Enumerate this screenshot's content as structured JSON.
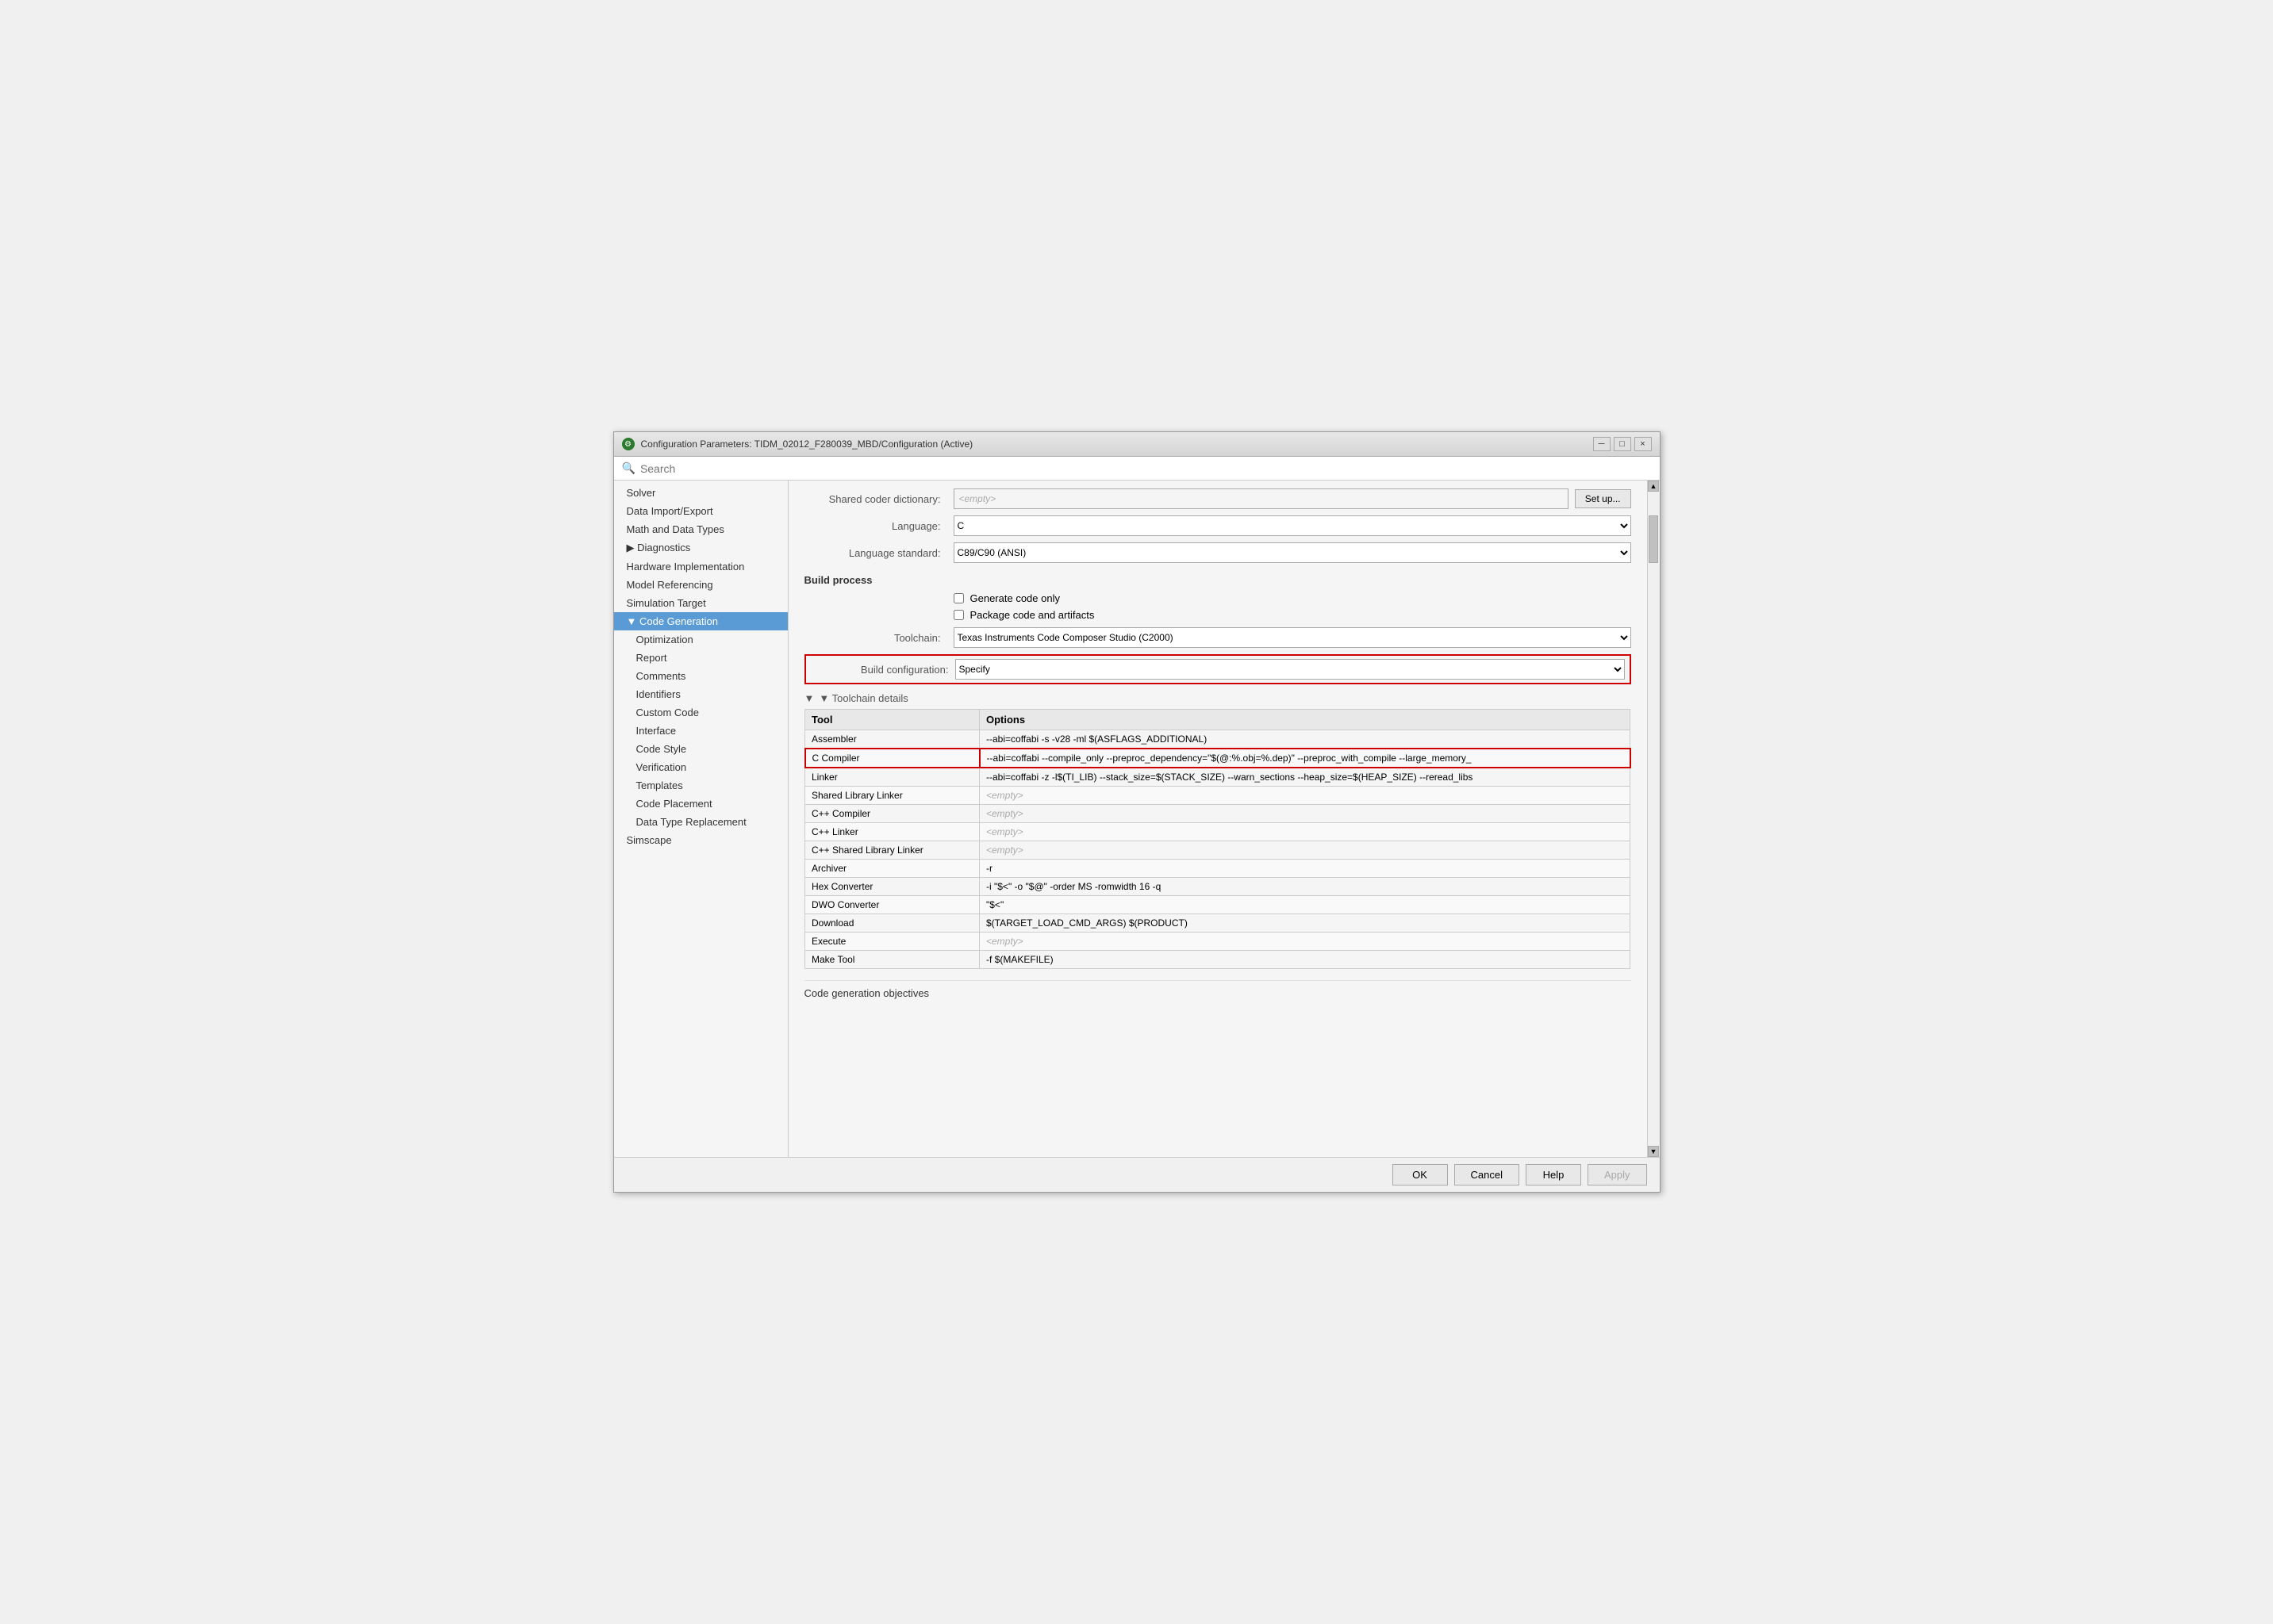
{
  "window": {
    "title": "Configuration Parameters: TIDM_02012_F280039_MBD/Configuration (Active)",
    "icon": "⚙"
  },
  "title_controls": {
    "minimize": "─",
    "maximize": "□",
    "close": "×"
  },
  "search": {
    "placeholder": "Search"
  },
  "sidebar": {
    "items": [
      {
        "id": "solver",
        "label": "Solver",
        "level": 0,
        "active": false
      },
      {
        "id": "data-import-export",
        "label": "Data Import/Export",
        "level": 0,
        "active": false
      },
      {
        "id": "math-data-types",
        "label": "Math and Data Types",
        "level": 0,
        "active": false
      },
      {
        "id": "diagnostics",
        "label": "▶ Diagnostics",
        "level": 0,
        "active": false
      },
      {
        "id": "hardware-impl",
        "label": "Hardware Implementation",
        "level": 0,
        "active": false
      },
      {
        "id": "model-referencing",
        "label": "Model Referencing",
        "level": 0,
        "active": false
      },
      {
        "id": "simulation-target",
        "label": "Simulation Target",
        "level": 0,
        "active": false
      },
      {
        "id": "code-generation",
        "label": "▼ Code Generation",
        "level": 0,
        "active": true
      },
      {
        "id": "optimization",
        "label": "Optimization",
        "level": 1,
        "active": false
      },
      {
        "id": "report",
        "label": "Report",
        "level": 1,
        "active": false
      },
      {
        "id": "comments",
        "label": "Comments",
        "level": 1,
        "active": false
      },
      {
        "id": "identifiers",
        "label": "Identifiers",
        "level": 1,
        "active": false
      },
      {
        "id": "custom-code",
        "label": "Custom Code",
        "level": 1,
        "active": false
      },
      {
        "id": "interface",
        "label": "Interface",
        "level": 1,
        "active": false
      },
      {
        "id": "code-style",
        "label": "Code Style",
        "level": 1,
        "active": false
      },
      {
        "id": "verification",
        "label": "Verification",
        "level": 1,
        "active": false
      },
      {
        "id": "templates",
        "label": "Templates",
        "level": 1,
        "active": false
      },
      {
        "id": "code-placement",
        "label": "Code Placement",
        "level": 1,
        "active": false
      },
      {
        "id": "data-type-replacement",
        "label": "Data Type Replacement",
        "level": 1,
        "active": false
      },
      {
        "id": "simscape",
        "label": "Simscape",
        "level": 0,
        "active": false
      }
    ]
  },
  "main": {
    "shared_coder_label": "Shared coder dictionary:",
    "shared_coder_value": "<empty>",
    "setup_btn": "Set up...",
    "language_label": "Language:",
    "language_value": "C",
    "language_standard_label": "Language standard:",
    "language_standard_value": "C89/C90 (ANSI)",
    "build_process_header": "Build process",
    "generate_code_only": "Generate code only",
    "package_code": "Package code and artifacts",
    "toolchain_label": "Toolchain:",
    "toolchain_value": "Texas Instruments Code Composer Studio (C2000)",
    "build_config_label": "Build configuration:",
    "build_config_value": "Specify",
    "toolchain_details_header": "▼ Toolchain details",
    "table": {
      "headers": [
        "Tool",
        "Options"
      ],
      "rows": [
        {
          "tool": "Assembler",
          "options": "--abi=coffabi -s -v28 -ml $(ASFLAGS_ADDITIONAL)",
          "highlighted": false,
          "empty": false
        },
        {
          "tool": "C Compiler",
          "options": "--abi=coffabi --compile_only --preproc_dependency=\"$(@:%.obj=%.dep)\" --preproc_with_compile --large_memory_",
          "highlighted": true,
          "empty": false
        },
        {
          "tool": "Linker",
          "options": "--abi=coffabi -z -l$(TI_LIB) --stack_size=$(STACK_SIZE) --warn_sections --heap_size=$(HEAP_SIZE) --reread_libs",
          "highlighted": false,
          "empty": false
        },
        {
          "tool": "Shared Library Linker",
          "options": "<empty>",
          "highlighted": false,
          "empty": true
        },
        {
          "tool": "C++ Compiler",
          "options": "<empty>",
          "highlighted": false,
          "empty": true
        },
        {
          "tool": "C++ Linker",
          "options": "<empty>",
          "highlighted": false,
          "empty": true
        },
        {
          "tool": "C++ Shared Library Linker",
          "options": "<empty>",
          "highlighted": false,
          "empty": true
        },
        {
          "tool": "Archiver",
          "options": "-r",
          "highlighted": false,
          "empty": false
        },
        {
          "tool": "Hex Converter",
          "options": "-i \"$<\" -o \"$@\" -order MS -romwidth 16 -q",
          "highlighted": false,
          "empty": false
        },
        {
          "tool": "DWO Converter",
          "options": "\"$<\"",
          "highlighted": false,
          "empty": false
        },
        {
          "tool": "Download",
          "options": "$(TARGET_LOAD_CMD_ARGS) $(PRODUCT)",
          "highlighted": false,
          "empty": false
        },
        {
          "tool": "Execute",
          "options": "<empty>",
          "highlighted": false,
          "empty": true
        },
        {
          "tool": "Make Tool",
          "options": "-f $(MAKEFILE)",
          "highlighted": false,
          "empty": false
        }
      ]
    },
    "code_gen_objectives": "Code generation objectives"
  },
  "bottom_bar": {
    "ok": "OK",
    "cancel": "Cancel",
    "help": "Help",
    "apply": "Apply"
  }
}
